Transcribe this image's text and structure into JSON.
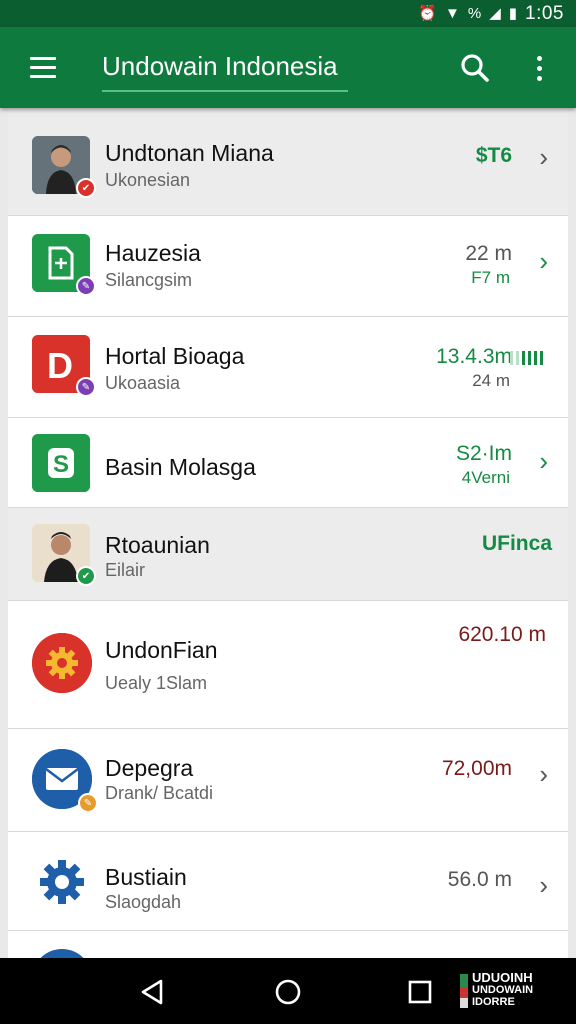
{
  "status_bar": {
    "time": "1:05",
    "icons": [
      "alarm-icon",
      "wifi-icon",
      "signal-icon",
      "battery-icon"
    ],
    "battery_label": "%"
  },
  "app_bar": {
    "title": "Undowain Indonesia",
    "icons": [
      "menu-icon",
      "search-icon",
      "more-vert-icon"
    ]
  },
  "colors": {
    "primary": "#0f7a3e",
    "primary_dark": "#0b5e30",
    "accent_green": "#158a44",
    "amount_red": "#7a1a1a"
  },
  "rows": [
    {
      "name": "Undtonan Miana",
      "sub": "Ukonesian",
      "amount": "$T6",
      "amount2": "",
      "amount_color": "green",
      "icon": "person-photo-icon",
      "badge": "red-badge",
      "trailing": "chevron"
    },
    {
      "name": "Hauzesia",
      "sub": "Silancgsim",
      "amount": "22 m",
      "amount2": "F7 m",
      "amount_color": "gray",
      "icon": "document-icon",
      "badge": "purple-badge",
      "trailing": "chevron-green"
    },
    {
      "name": "Hortal Bioaga",
      "sub": "Ukoaasia",
      "amount": "13.4.3m",
      "amount2": "24 m",
      "amount_color": "green",
      "icon": "letter-d-icon",
      "badge": "purple-badge",
      "trailing": "bars"
    },
    {
      "name": "Basin Molasga",
      "sub": "",
      "amount": "S2·Im",
      "amount2": "4Verni",
      "amount_color": "green",
      "icon": "letter-s-icon",
      "badge": "",
      "trailing": "chevron-green"
    },
    {
      "name": "Rtoaunian",
      "sub": "Eilair",
      "amount": "UFinca",
      "amount2": "",
      "amount_color": "green",
      "icon": "person-photo-icon",
      "badge": "green-badge",
      "trailing": ""
    },
    {
      "name": "UndonFian",
      "sub": "Uealy 1Slam",
      "amount": "620.10 m",
      "amount2": "",
      "amount_color": "red",
      "icon": "gear-icon",
      "badge": "",
      "trailing": ""
    },
    {
      "name": "Depegra",
      "sub": "Drank/ Bcatdi",
      "amount": "72,00m",
      "amount2": "",
      "amount_color": "red",
      "icon": "mail-icon",
      "badge": "orange-badge",
      "trailing": "chevron"
    },
    {
      "name": "Bustiain",
      "sub": "Slaogdah",
      "amount": "56.0 m",
      "amount2": "",
      "amount_color": "gray",
      "icon": "settings-gear-icon",
      "badge": "",
      "trailing": "chevron"
    }
  ],
  "nav_bar": {
    "buttons": [
      "back-icon",
      "home-icon",
      "recents-icon"
    ],
    "logo_line1": "UDUOINH",
    "logo_line2": "UNDOWAIN",
    "logo_line3": "IDORRE"
  }
}
